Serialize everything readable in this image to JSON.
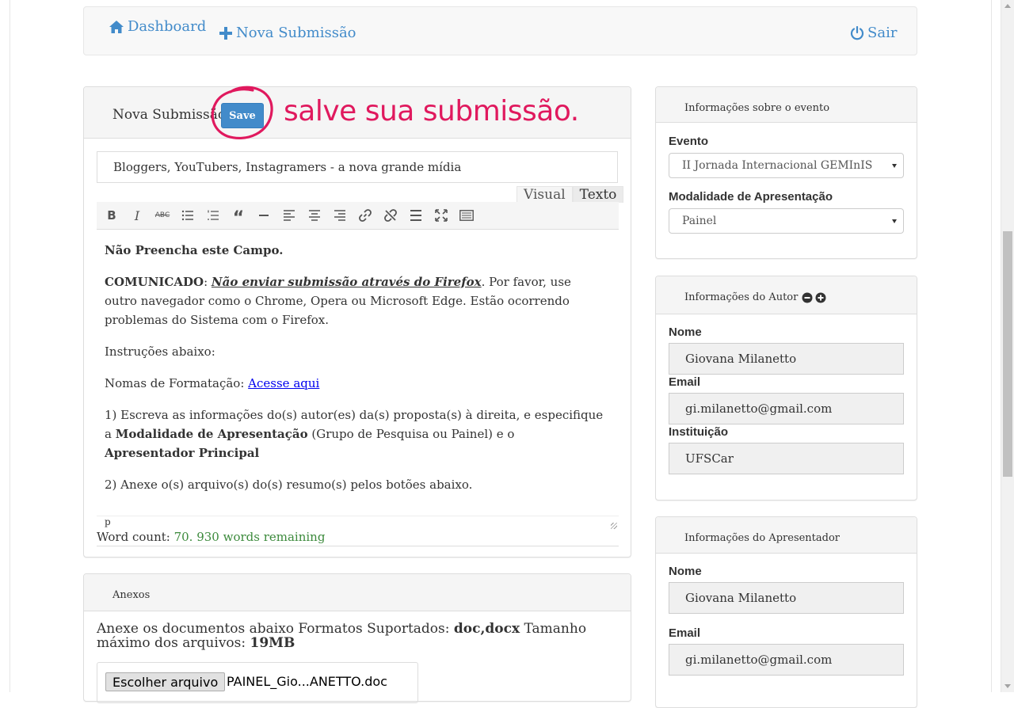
{
  "nav": {
    "dashboard": "Dashboard",
    "nova_submissao": "Nova Submissão",
    "sair": "Sair"
  },
  "submission": {
    "heading": "Nova Submissão",
    "save_label": "Save",
    "annotation": "salve sua submissão.",
    "title_value": "Bloggers, YouTubers, Instagramers - a nova grande mídia",
    "tabs": {
      "visual": "Visual",
      "texto": "Texto"
    },
    "toolbar_icons": [
      "bold-icon",
      "italic-icon",
      "strikethrough-icon",
      "bullet-list-icon",
      "numbered-list-icon",
      "blockquote-icon",
      "horizontal-rule-icon",
      "align-left-icon",
      "align-center-icon",
      "align-right-icon",
      "link-icon",
      "unlink-icon",
      "read-more-icon",
      "fullscreen-icon",
      "toolbar-toggle-icon"
    ],
    "content": {
      "p1": "Não Preencha este Campo.",
      "p2_label": "COMUNICADO",
      "p2_colon": ": ",
      "p2_emph": "Não enviar submissão através do Firefox",
      "p2_rest": ". Por favor, use outro navegador como o Chrome, Opera ou Microsoft Edge. Estão ocorrendo problemas do Sistema com o Firefox.",
      "p3": "Instruções abaixo:",
      "p4_text": "Nomas de Formatação: ",
      "p4_link": "Acesse aqui",
      "p5_a": "1) Escreva as informações do(s) autor(es) da(s) proposta(s) à direita, e especifique a ",
      "p5_b1": "Modalidade de Apresentação",
      "p5_c": " (Grupo de Pesquisa ou Painel) e o ",
      "p5_b2": "Apresentador Principal",
      "p6": "2) Anexe o(s) arquivo(s) do(s) resumo(s) pelos botões abaixo."
    },
    "path": "p",
    "wordcount_label": "Word count: ",
    "wordcount_value": "70. 930 words remaining"
  },
  "anexos": {
    "heading": "Anexos",
    "text_a": "Anexe os documentos abaixo Formatos Suportados: ",
    "formats": "doc,docx",
    "text_b": " Tamanho máximo dos arquivos: ",
    "max_size": "19MB",
    "file_button": "Escolher arquivo",
    "file_name": "PAINEL_Gio...ANETTO.doc"
  },
  "evento": {
    "heading": "Informações sobre o evento",
    "evento_label": "Evento",
    "evento_value": "II Jornada Internacional GEMInIS",
    "modalidade_label": "Modalidade de Apresentação",
    "modalidade_value": "Painel"
  },
  "autor": {
    "heading": "Informações do Autor",
    "nome_label": "Nome",
    "nome_value": "Giovana Milanetto",
    "email_label": "Email",
    "email_value": "gi.milanetto@gmail.com",
    "instituicao_label": "Instituição",
    "instituicao_value": "UFSCar"
  },
  "apresentador": {
    "heading": "Informações do Apresentador",
    "nome_label": "Nome",
    "nome_value": "Giovana Milanetto",
    "email_label": "Email",
    "email_value": "gi.milanetto@gmail.com"
  },
  "colors": {
    "link": "#428bca",
    "primary_button": "#428bca",
    "annotation": "#e0195e",
    "wordcount": "#3c8a3c"
  }
}
